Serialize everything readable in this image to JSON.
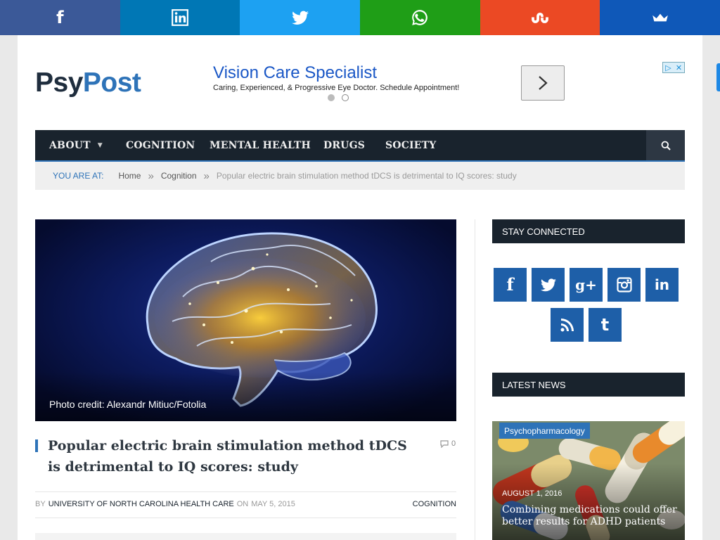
{
  "share_bar": [
    {
      "network": "facebook",
      "icon": "facebook-icon",
      "color": "#3b5998"
    },
    {
      "network": "linkedin",
      "icon": "linkedin-icon",
      "color": "#0077b5"
    },
    {
      "network": "twitter",
      "icon": "twitter-icon",
      "color": "#1da1f2"
    },
    {
      "network": "whatsapp",
      "icon": "whatsapp-icon",
      "color": "#1f9e17"
    },
    {
      "network": "stumbleupon",
      "icon": "stumbleupon-icon",
      "color": "#eb4924"
    },
    {
      "network": "sumome",
      "icon": "crown-icon",
      "color": "#0f58b8"
    }
  ],
  "logo": {
    "part1": "Psy",
    "part2": "Post"
  },
  "ad": {
    "title": "Vision Care Specialist",
    "description": "Caring, Experienced, & Progressive Eye Doctor. Schedule Appointment!",
    "arrow_icon": "chevron-right-icon",
    "active_dot": 1,
    "choice_icons": [
      "adchoices-icon",
      "close-icon"
    ]
  },
  "nav": {
    "items": [
      "About",
      "Cognition",
      "Mental Health",
      "Drugs",
      "Society"
    ],
    "search_icon": "search-icon"
  },
  "breadcrumb": {
    "label": "You Are At:",
    "items": [
      "Home",
      "Cognition"
    ],
    "current": "Popular electric brain stimulation method tDCS is detrimental to IQ scores: study"
  },
  "article": {
    "photo_credit": "Photo credit: Alexandr Mitiuc/Fotolia",
    "title": "Popular electric brain stimulation method tDCS is detrimental to IQ scores: study",
    "comment_count": "0",
    "by_label": "By",
    "author": "University of North Carolina Health Care",
    "on_label": "on",
    "date": "May 5, 2015",
    "category": "Cognition"
  },
  "sidebar": {
    "stay_connected": "Stay Connected",
    "social": [
      "facebook",
      "twitter",
      "google-plus",
      "instagram",
      "linkedin",
      "rss",
      "tumblr"
    ],
    "latest_news": "Latest News",
    "news": {
      "tag": "Psychopharmacology",
      "date": "August 1, 2016",
      "title": "Combining medications could offer better results for ADHD patients"
    }
  }
}
